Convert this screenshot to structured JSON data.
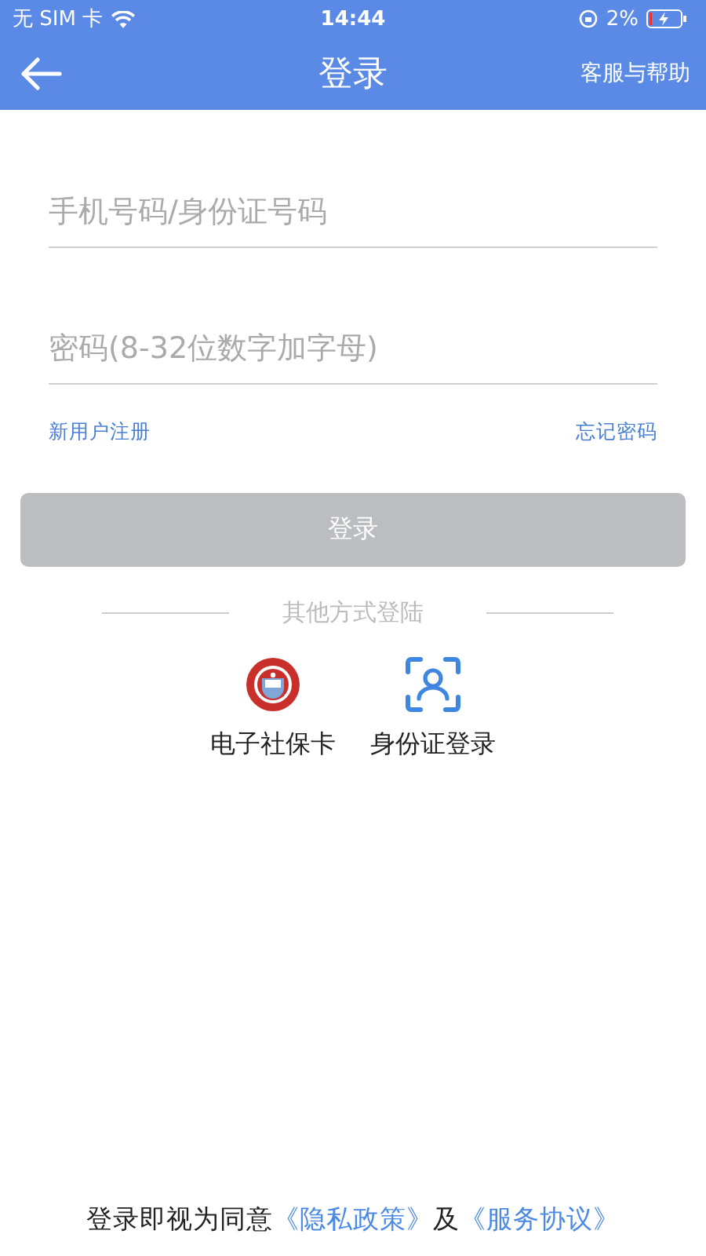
{
  "status_bar": {
    "carrier": "无 SIM 卡",
    "time": "14:44",
    "battery": "2%"
  },
  "nav": {
    "title": "登录",
    "action": "客服与帮助"
  },
  "fields": [
    {
      "placeholder": "手机号码/身份证号码"
    },
    {
      "placeholder": "密码(8-32位数字加字母)"
    }
  ],
  "links": [
    "新用户注册",
    "忘记密码"
  ],
  "login_button": {
    "label": "登录",
    "disabled": true
  },
  "divider_label": "其他方式登陆",
  "alt_logins": [
    {
      "kind": "badge",
      "label": "电子社保卡"
    },
    {
      "kind": "face",
      "label": "身份证登录"
    }
  ],
  "agreement": {
    "text": "登录即视为同意",
    "links": [
      "《隐私政策》",
      "《服务协议》"
    ],
    "joiner": "及"
  }
}
